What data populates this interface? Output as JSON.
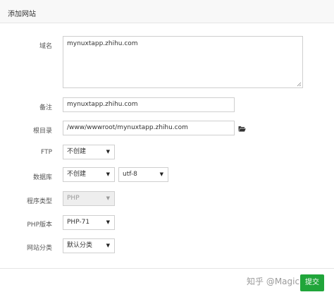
{
  "dialog": {
    "title": "添加网站"
  },
  "form": {
    "domain": {
      "label": "域名",
      "value": "mynuxtapp.zhihu.com"
    },
    "remark": {
      "label": "备注",
      "value": "mynuxtapp.zhihu.com"
    },
    "root_dir": {
      "label": "根目录",
      "value": "/www/wwwroot/mynuxtapp.zhihu.com"
    },
    "ftp": {
      "label": "FTP",
      "selected": "不创建"
    },
    "database": {
      "label": "数据库",
      "selected": "不创建",
      "charset": "utf-8"
    },
    "program_type": {
      "label": "程序类型",
      "selected": "PHP"
    },
    "php_version": {
      "label": "PHP版本",
      "selected": "PHP-71"
    },
    "site_category": {
      "label": "网站分类",
      "selected": "默认分类"
    }
  },
  "footer": {
    "watermark": "知乎 @Magiclock",
    "submit_label": "提交"
  },
  "icons": {
    "folder": "folder-open-icon",
    "caret": "caret-down-icon",
    "resize": "resize-handle-icon"
  },
  "colors": {
    "submit": "#20a53a"
  }
}
